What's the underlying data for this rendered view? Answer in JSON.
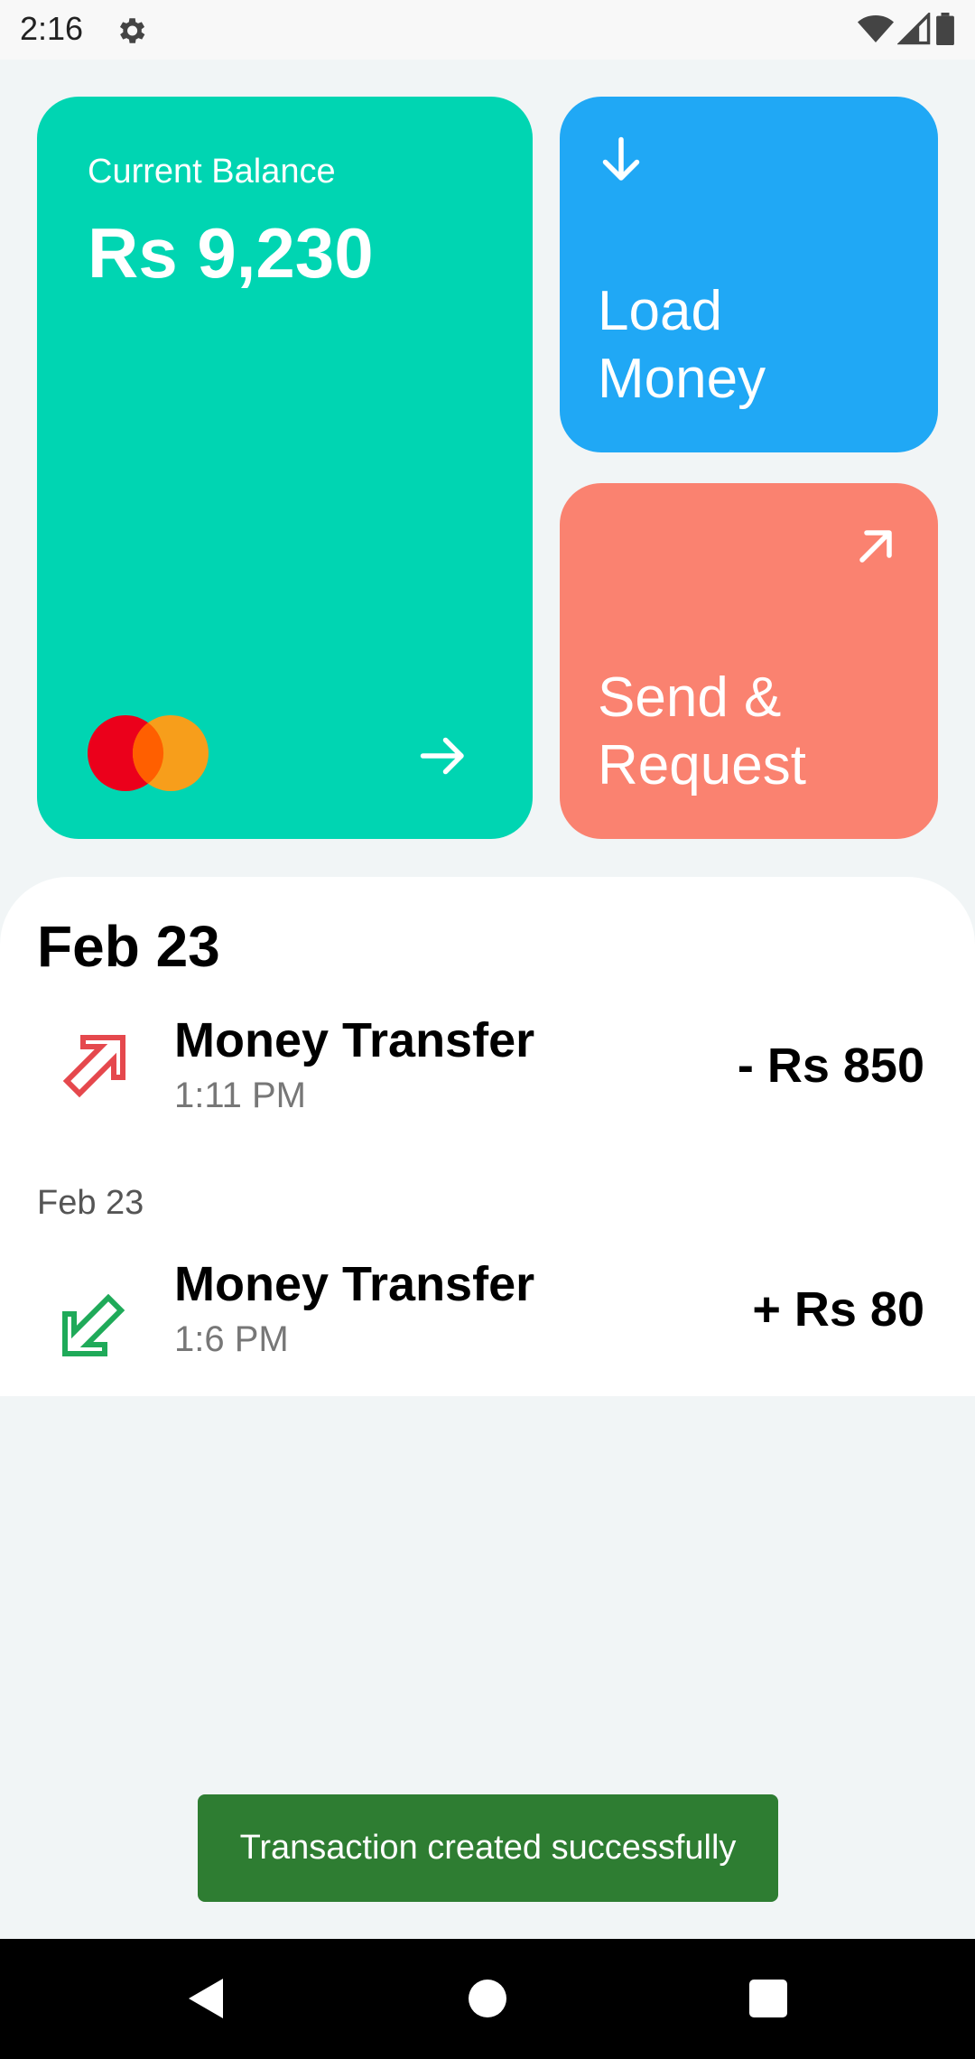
{
  "status_bar": {
    "time": "2:16",
    "icons": [
      "gear-icon",
      "wifi-icon",
      "signal-icon",
      "battery-icon"
    ]
  },
  "balance_card": {
    "label": "Current Balance",
    "amount": "Rs 9,230",
    "color": "#00D5B2",
    "brand_icon": "mastercard-logo",
    "action_icon": "arrow-right-icon"
  },
  "load_money": {
    "label": "Load Money",
    "color": "#20A8F5",
    "icon": "arrow-down-icon"
  },
  "send_request": {
    "label": "Send & Request",
    "color": "#FA8270",
    "icon": "arrow-up-right-icon"
  },
  "transactions": {
    "heading": "Feb 23",
    "subheading": "Feb 23",
    "items": [
      {
        "title": "Money Transfer",
        "time": "1:11 PM",
        "amount": "- Rs 850",
        "direction": "outgoing",
        "icon": "outgoing-arrow-icon",
        "icon_color": "#E5484D"
      },
      {
        "title": "Money Transfer",
        "time": "1:6 PM",
        "amount": "+ Rs 80",
        "direction": "incoming",
        "icon": "incoming-arrow-icon",
        "icon_color": "#1FAA59"
      }
    ]
  },
  "snackbar": {
    "message": "Transaction created successfully",
    "color": "#2E7D32"
  },
  "nav_bar": {
    "buttons": [
      "back-icon",
      "home-icon",
      "recents-icon"
    ]
  }
}
